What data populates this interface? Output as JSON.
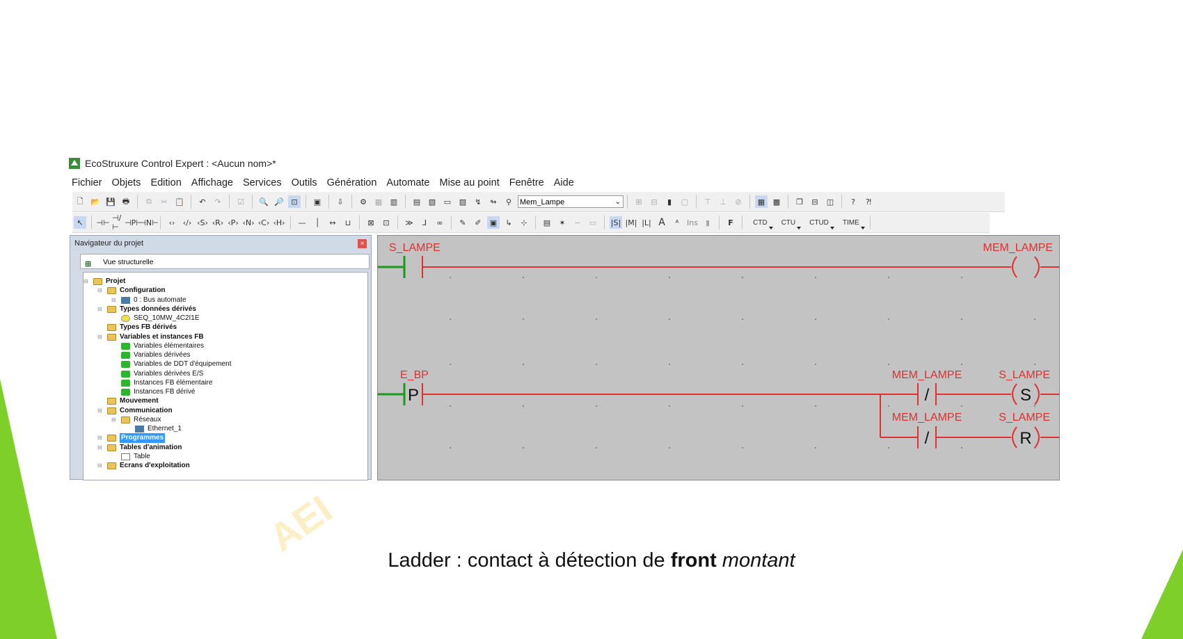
{
  "app": {
    "title": "EcoStruxure Control Expert : <Aucun nom>*"
  },
  "menu": [
    "Fichier",
    "Objets",
    "Edition",
    "Affichage",
    "Services",
    "Outils",
    "Génération",
    "Automate",
    "Mise au point",
    "Fenêtre",
    "Aide"
  ],
  "toolbar": {
    "variable_combo": "Mem_Lampe",
    "block_buttons": [
      "CTD",
      "CTU",
      "CTUD",
      "TIME"
    ],
    "text_buttons": [
      "Ins",
      "F"
    ]
  },
  "navigator": {
    "title": "Navigateur du projet",
    "view": "Vue structurelle",
    "tree": [
      {
        "label": "Projet",
        "bold": true
      },
      {
        "label": "Configuration",
        "bold": true
      },
      {
        "label": "0 : Bus automate",
        "bold": false
      },
      {
        "label": "Types données dérivés",
        "bold": true
      },
      {
        "label": "SEQ_10MW_4C2I1E",
        "bold": false
      },
      {
        "label": "Types FB dérivés",
        "bold": true
      },
      {
        "label": "Variables et instances FB",
        "bold": true
      },
      {
        "label": "Variables élémentaires",
        "bold": false
      },
      {
        "label": "Variables dérivées",
        "bold": false
      },
      {
        "label": "Variables de DDT d'équipement",
        "bold": false
      },
      {
        "label": "Variables dérivées E/S",
        "bold": false
      },
      {
        "label": "Instances FB élémentaire",
        "bold": false
      },
      {
        "label": "Instances FB dérivé",
        "bold": false
      },
      {
        "label": "Mouvement",
        "bold": true
      },
      {
        "label": "Communication",
        "bold": true
      },
      {
        "label": "Réseaux",
        "bold": false
      },
      {
        "label": "Ethernet_1",
        "bold": false
      },
      {
        "label": "Programmes",
        "bold": true
      },
      {
        "label": "Tables d'animation",
        "bold": true
      },
      {
        "label": "Table",
        "bold": false
      },
      {
        "label": "Ecrans d'exploitation",
        "bold": true
      }
    ]
  },
  "ladder": {
    "rung1": {
      "contact": "S_LAMPE",
      "coil": "MEM_LAMPE"
    },
    "rung2": {
      "contact": "E_BP",
      "contact_symbol": "P",
      "branch1": {
        "contact": "MEM_LAMPE",
        "contact_symbol": "/",
        "coil": "S_LAMPE",
        "coil_symbol": "S"
      },
      "branch2": {
        "contact": "MEM_LAMPE",
        "contact_symbol": "/",
        "coil": "S_LAMPE",
        "coil_symbol": "R"
      }
    },
    "colors": {
      "wire": "#e03030",
      "power": "#1a9a1a",
      "background": "#c3c3c3"
    }
  },
  "watermark": "AEI",
  "caption": {
    "prefix": "Ladder : contact à détection de ",
    "bold": "front",
    "italic": "montant"
  },
  "colors": {
    "accent_green": "#7ecf2a",
    "caption": "#111111"
  }
}
